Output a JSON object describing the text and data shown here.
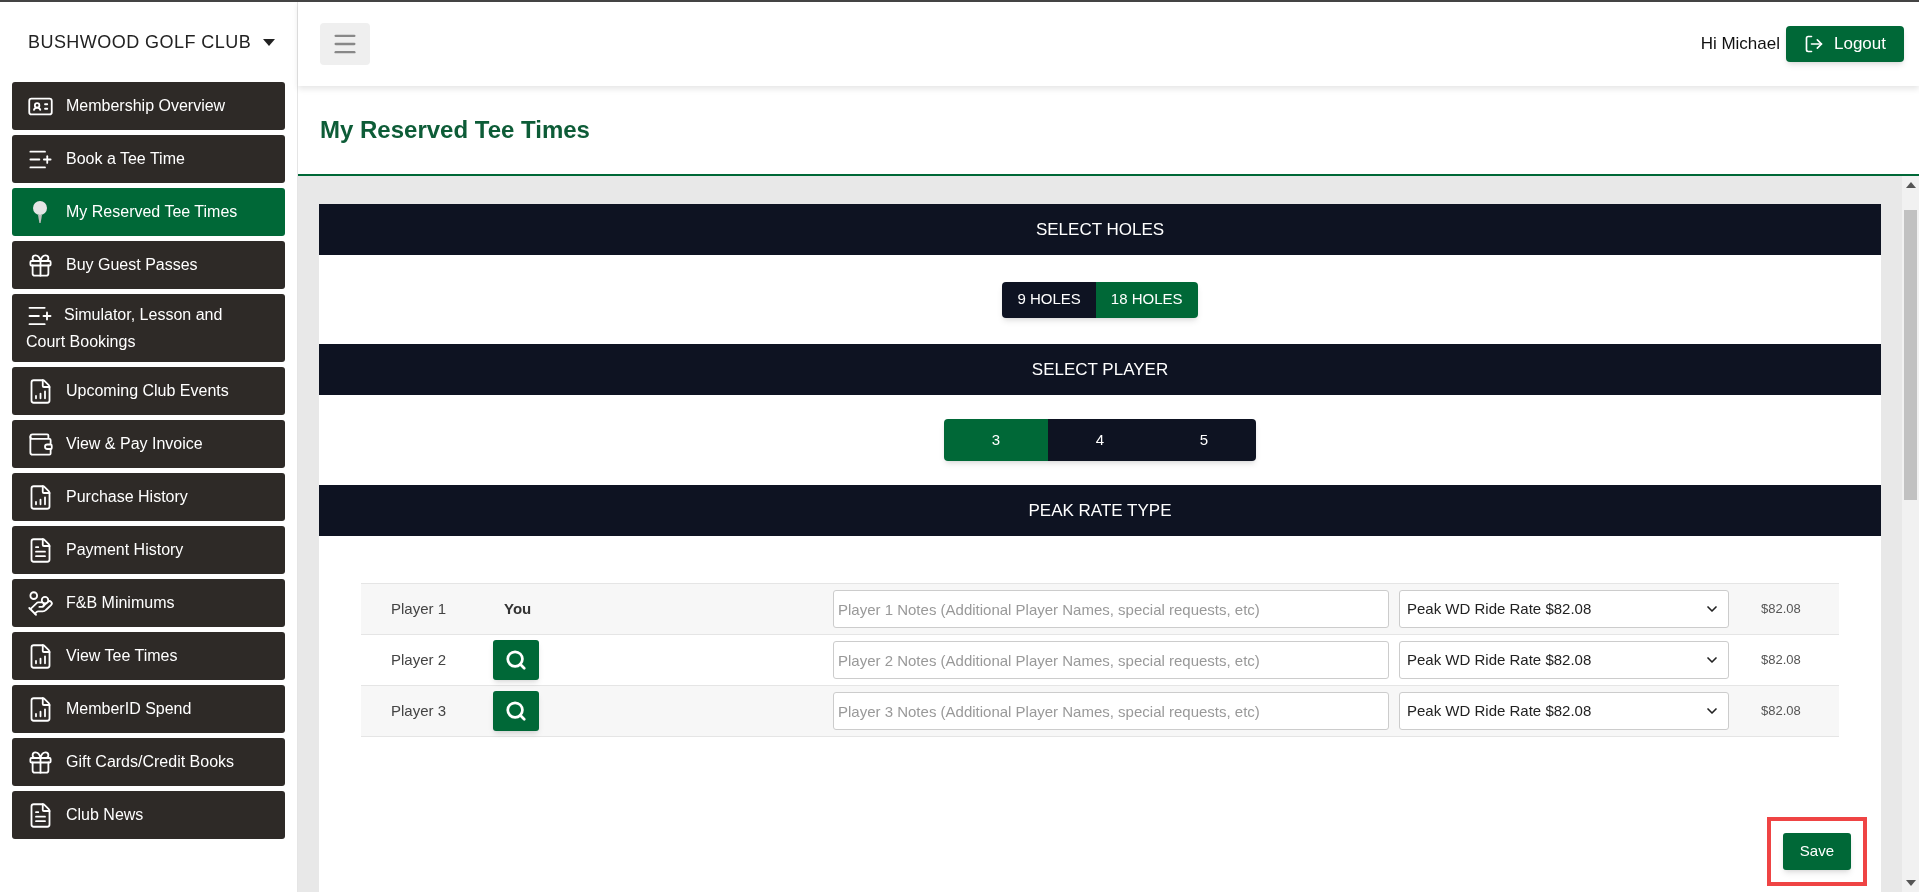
{
  "brand": {
    "name": "BUSHWOOD GOLF CLUB"
  },
  "sidebar": {
    "items": [
      {
        "label": "Membership Overview",
        "selected": false
      },
      {
        "label": "Book a Tee Time",
        "selected": false
      },
      {
        "label": "My Reserved Tee Times",
        "selected": true
      },
      {
        "label": "Buy Guest Passes",
        "selected": false
      },
      {
        "label": "Simulator, Lesson and Court Bookings",
        "selected": false
      },
      {
        "label": "Upcoming Club Events",
        "selected": false
      },
      {
        "label": "View & Pay Invoice",
        "selected": false
      },
      {
        "label": "Purchase History",
        "selected": false
      },
      {
        "label": "Payment History",
        "selected": false
      },
      {
        "label": "F&B Minimums",
        "selected": false
      },
      {
        "label": "View Tee Times",
        "selected": false
      },
      {
        "label": "MemberID Spend",
        "selected": false
      },
      {
        "label": "Gift Cards/Credit Books",
        "selected": false
      },
      {
        "label": "Club News",
        "selected": false
      }
    ]
  },
  "header": {
    "greeting": "Hi Michael",
    "logout": "Logout"
  },
  "page": {
    "title": "My Reserved Tee Times"
  },
  "holes": {
    "heading": "SELECT HOLES",
    "options": [
      {
        "label": "9 HOLES",
        "selected": false
      },
      {
        "label": "18 HOLES",
        "selected": true
      }
    ]
  },
  "players": {
    "heading": "SELECT PLAYER",
    "options": [
      {
        "label": "3",
        "selected": true
      },
      {
        "label": "4",
        "selected": false
      },
      {
        "label": "5",
        "selected": false
      }
    ]
  },
  "rate": {
    "heading": "PEAK RATE TYPE"
  },
  "rows": [
    {
      "player": "Player 1",
      "kind": "you",
      "who": "You",
      "placeholder": "Player 1 Notes (Additional Player Names, special requests, etc)",
      "rate": "Peak WD Ride Rate $82.08",
      "price": "$82.08"
    },
    {
      "player": "Player 2",
      "kind": "search",
      "placeholder": "Player 2 Notes (Additional Player Names, special requests, etc)",
      "rate": "Peak WD Ride Rate $82.08",
      "price": "$82.08"
    },
    {
      "player": "Player 3",
      "kind": "search",
      "placeholder": "Player 3 Notes (Additional Player Names, special requests, etc)",
      "rate": "Peak WD Ride Rate $82.08",
      "price": "$82.08"
    }
  ],
  "save": {
    "label": "Save",
    "highlighted": true
  }
}
